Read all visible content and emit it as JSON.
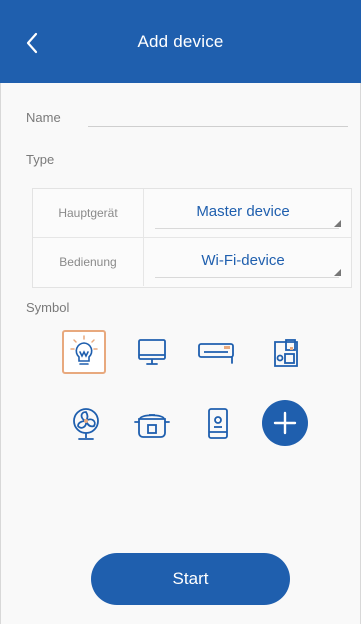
{
  "header": {
    "title": "Add device",
    "back_icon": "chevron-left-icon",
    "color": "#1f5fae"
  },
  "name": {
    "label": "Name",
    "value": "",
    "placeholder": ""
  },
  "type": {
    "label": "Type",
    "rows": [
      {
        "key": "Hauptgerät",
        "value": "Master device"
      },
      {
        "key": "Bedienung",
        "value": "Wi-Fi-device"
      }
    ]
  },
  "symbol": {
    "label": "Symbol",
    "icons": [
      "light-bulb-icon",
      "monitor-icon",
      "air-conditioner-icon",
      "coffee-machine-icon",
      "fan-icon",
      "rice-cooker-icon",
      "fridge-icon",
      "add-icon"
    ],
    "selected_icon": "light-bulb-icon",
    "selected_border_color": "#e8a97e"
  },
  "start_label": "Start"
}
